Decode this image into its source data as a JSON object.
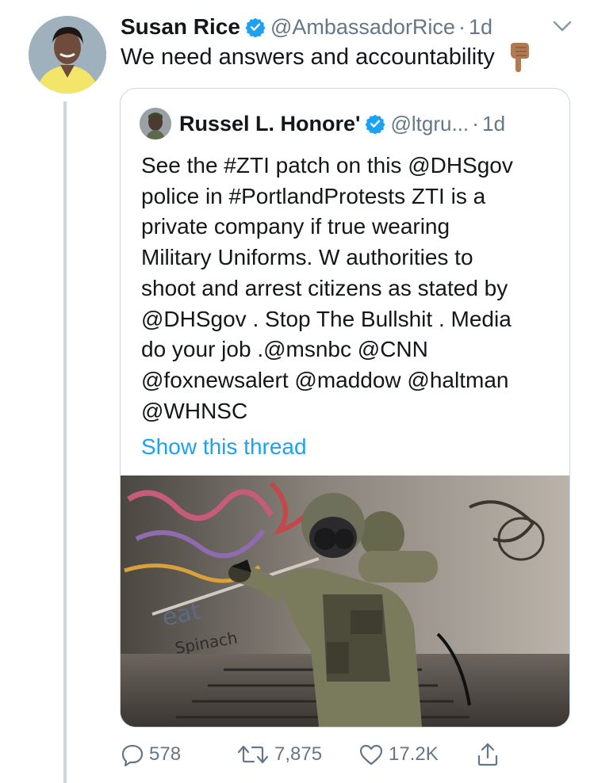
{
  "tweet": {
    "author_name": "Susan Rice",
    "handle": "@AmbassadorRice",
    "separator": "·",
    "time": "1d",
    "text": "We need answers and accountability",
    "emoji": "pointing-down-emoji"
  },
  "quoted": {
    "author_name": "Russel L. Honore'",
    "handle": "@ltgru...",
    "separator": "·",
    "time": "1d",
    "text": "See the #ZTI patch on this @DHSgov\npolice in #PortlandProtests ZTI is a\nprivate company if true wearing\nMilitary Uniforms. W authorities to\nshoot and arrest citizens as stated by\n@DHSgov . Stop The Bullshit . Media\ndo your job .@msnbc @CNN\n@foxnewsalert @maddow @haltman\n@WHNSC",
    "show_thread": "Show this thread"
  },
  "actions": {
    "replies": "578",
    "retweets": "7,875",
    "likes": "17.2K"
  },
  "icons": [
    "verified-badge-icon",
    "chevron-down-icon",
    "reply-icon",
    "retweet-icon",
    "like-icon",
    "share-icon"
  ],
  "colors": {
    "link": "#1da1f2",
    "secondary_text": "#657786",
    "border": "#ccd6dd",
    "verified": "#1da1f2"
  }
}
